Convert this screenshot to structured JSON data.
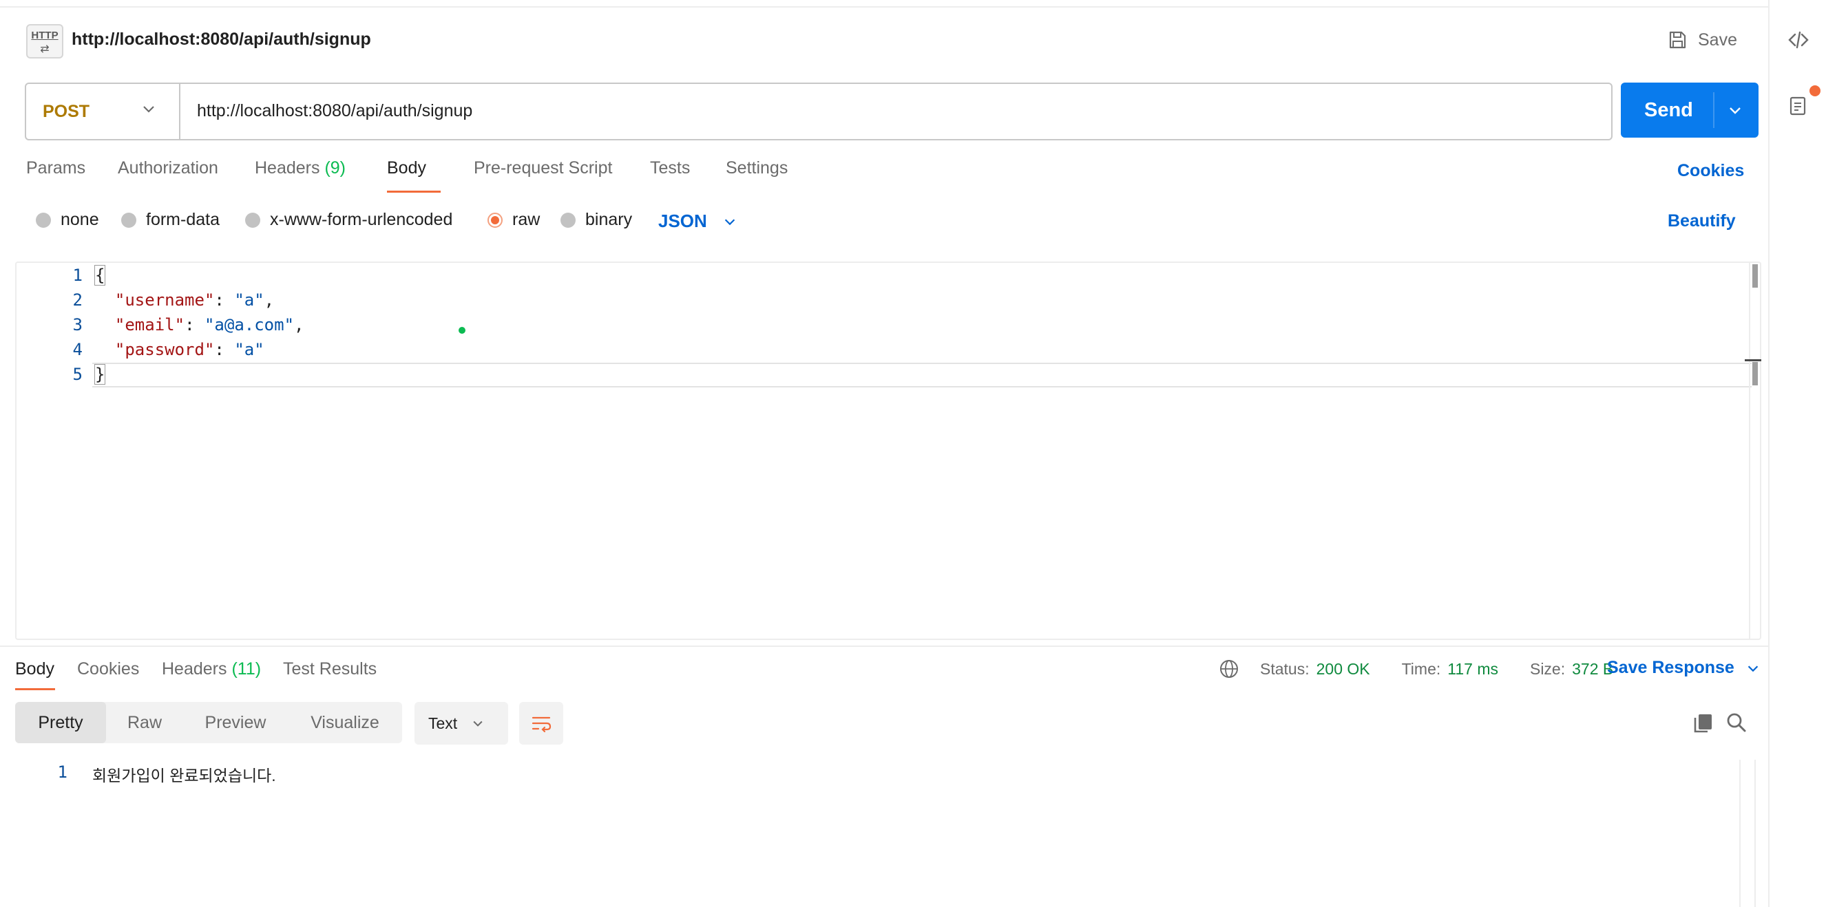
{
  "request": {
    "badge_label": "HTTP",
    "title": "http://localhost:8080/api/auth/signup",
    "save_label": "Save",
    "method": "POST",
    "url": "http://localhost:8080/api/auth/signup",
    "send_label": "Send"
  },
  "request_tabs": {
    "params": "Params",
    "authorization": "Authorization",
    "headers": "Headers",
    "headers_count": "(9)",
    "body": "Body",
    "prerequest": "Pre-request Script",
    "tests": "Tests",
    "settings": "Settings",
    "cookies": "Cookies"
  },
  "body_modes": {
    "none": "none",
    "form_data": "form-data",
    "urlencoded": "x-www-form-urlencoded",
    "raw": "raw",
    "binary": "binary",
    "selected": "raw",
    "language": "JSON",
    "beautify": "Beautify"
  },
  "editor": {
    "line_numbers": [
      "1",
      "2",
      "3",
      "4",
      "5"
    ],
    "open_brace": "{",
    "close_brace": "}",
    "key_username": "\"username\"",
    "val_username": "\"a\"",
    "key_email": "\"email\"",
    "val_email": "\"a@a.com\"",
    "key_password": "\"password\"",
    "val_password": "\"a\"",
    "colon": ": ",
    "comma": ","
  },
  "response_tabs": {
    "body": "Body",
    "cookies": "Cookies",
    "headers": "Headers",
    "headers_count": "(11)",
    "test_results": "Test Results"
  },
  "response_status": {
    "status_label": "Status:",
    "status_value": "200 OK",
    "time_label": "Time:",
    "time_value": "117 ms",
    "size_label": "Size:",
    "size_value": "372 B",
    "save_response": "Save Response"
  },
  "response_view": {
    "pretty": "Pretty",
    "raw": "Raw",
    "preview": "Preview",
    "visualize": "Visualize",
    "format": "Text",
    "line_number": "1",
    "body_text": "회원가입이 완료되었습니다."
  },
  "icons": {
    "rail_code": "code-icon",
    "rail_doc": "document-info-icon",
    "save": "save-disk-icon",
    "globe": "globe-icon",
    "copy": "copy-icon",
    "search": "search-icon",
    "wrap": "wrap-lines-icon"
  },
  "colors": {
    "accent": "#f26b3a",
    "send_blue": "#097bed",
    "link_blue": "#0265d2",
    "method_post": "#ad7a03",
    "status_green": "#0f8a3e"
  }
}
